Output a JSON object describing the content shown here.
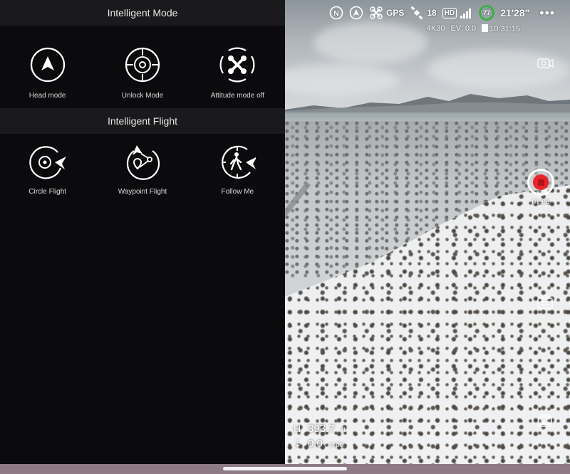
{
  "intelligent_mode": {
    "title": "Intelligent Mode",
    "items": [
      {
        "label": "Head mode",
        "icon": "head-mode-icon"
      },
      {
        "label": "Unlock Mode",
        "icon": "unlock-mode-icon"
      },
      {
        "label": "Attitude mode off",
        "icon": "attitude-mode-icon"
      }
    ]
  },
  "intelligent_flight": {
    "title": "Intelligent Flight",
    "items": [
      {
        "label": "Circle Flight",
        "icon": "circle-flight-icon"
      },
      {
        "label": "Waypoint Flight",
        "icon": "waypoint-flight-icon"
      },
      {
        "label": "Follow Me",
        "icon": "follow-me-icon"
      }
    ]
  },
  "status_bar": {
    "gps_label": "GPS",
    "satellites": "18",
    "hd_label": "HD",
    "battery_level": "77",
    "flight_time": "21'28\"",
    "more": "•••"
  },
  "camera_info": {
    "resolution": "4K30",
    "ev": "EV: 0.0",
    "storage_time": "10:31:15"
  },
  "recording": {
    "time": "01:04",
    "color": "#e8242a"
  },
  "telemetry": {
    "height_key": "H",
    "height_value": "393.7",
    "height_unit": "ft",
    "speed_key": "⇣",
    "speed_value": "0.0",
    "speed_unit": "mph"
  },
  "colors": {
    "panel_bg": "#0b0b0d",
    "header_bg": "#1a1a1c",
    "battery_green": "#3fae4a"
  }
}
